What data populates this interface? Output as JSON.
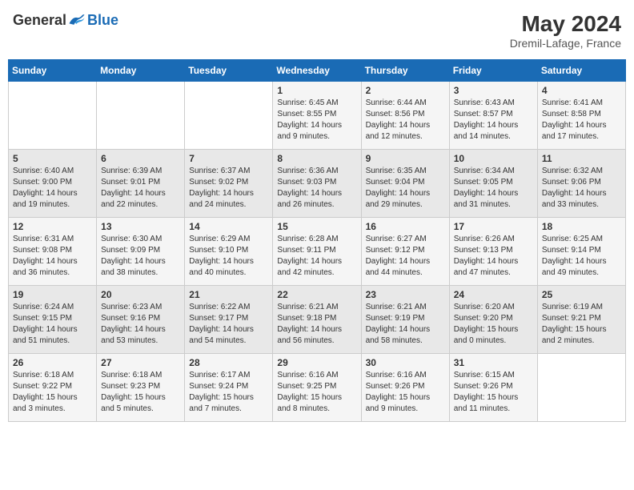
{
  "header": {
    "logo_general": "General",
    "logo_blue": "Blue",
    "month_title": "May 2024",
    "location": "Dremil-Lafage, France"
  },
  "days_of_week": [
    "Sunday",
    "Monday",
    "Tuesday",
    "Wednesday",
    "Thursday",
    "Friday",
    "Saturday"
  ],
  "weeks": [
    {
      "days": [
        {
          "num": "",
          "empty": true
        },
        {
          "num": "",
          "empty": true
        },
        {
          "num": "",
          "empty": true
        },
        {
          "num": "1",
          "sunrise": "6:45 AM",
          "sunset": "8:55 PM",
          "daylight": "14 hours and 9 minutes."
        },
        {
          "num": "2",
          "sunrise": "6:44 AM",
          "sunset": "8:56 PM",
          "daylight": "14 hours and 12 minutes."
        },
        {
          "num": "3",
          "sunrise": "6:43 AM",
          "sunset": "8:57 PM",
          "daylight": "14 hours and 14 minutes."
        },
        {
          "num": "4",
          "sunrise": "6:41 AM",
          "sunset": "8:58 PM",
          "daylight": "14 hours and 17 minutes."
        }
      ]
    },
    {
      "days": [
        {
          "num": "5",
          "sunrise": "6:40 AM",
          "sunset": "9:00 PM",
          "daylight": "14 hours and 19 minutes."
        },
        {
          "num": "6",
          "sunrise": "6:39 AM",
          "sunset": "9:01 PM",
          "daylight": "14 hours and 22 minutes."
        },
        {
          "num": "7",
          "sunrise": "6:37 AM",
          "sunset": "9:02 PM",
          "daylight": "14 hours and 24 minutes."
        },
        {
          "num": "8",
          "sunrise": "6:36 AM",
          "sunset": "9:03 PM",
          "daylight": "14 hours and 26 minutes."
        },
        {
          "num": "9",
          "sunrise": "6:35 AM",
          "sunset": "9:04 PM",
          "daylight": "14 hours and 29 minutes."
        },
        {
          "num": "10",
          "sunrise": "6:34 AM",
          "sunset": "9:05 PM",
          "daylight": "14 hours and 31 minutes."
        },
        {
          "num": "11",
          "sunrise": "6:32 AM",
          "sunset": "9:06 PM",
          "daylight": "14 hours and 33 minutes."
        }
      ]
    },
    {
      "days": [
        {
          "num": "12",
          "sunrise": "6:31 AM",
          "sunset": "9:08 PM",
          "daylight": "14 hours and 36 minutes."
        },
        {
          "num": "13",
          "sunrise": "6:30 AM",
          "sunset": "9:09 PM",
          "daylight": "14 hours and 38 minutes."
        },
        {
          "num": "14",
          "sunrise": "6:29 AM",
          "sunset": "9:10 PM",
          "daylight": "14 hours and 40 minutes."
        },
        {
          "num": "15",
          "sunrise": "6:28 AM",
          "sunset": "9:11 PM",
          "daylight": "14 hours and 42 minutes."
        },
        {
          "num": "16",
          "sunrise": "6:27 AM",
          "sunset": "9:12 PM",
          "daylight": "14 hours and 44 minutes."
        },
        {
          "num": "17",
          "sunrise": "6:26 AM",
          "sunset": "9:13 PM",
          "daylight": "14 hours and 47 minutes."
        },
        {
          "num": "18",
          "sunrise": "6:25 AM",
          "sunset": "9:14 PM",
          "daylight": "14 hours and 49 minutes."
        }
      ]
    },
    {
      "days": [
        {
          "num": "19",
          "sunrise": "6:24 AM",
          "sunset": "9:15 PM",
          "daylight": "14 hours and 51 minutes."
        },
        {
          "num": "20",
          "sunrise": "6:23 AM",
          "sunset": "9:16 PM",
          "daylight": "14 hours and 53 minutes."
        },
        {
          "num": "21",
          "sunrise": "6:22 AM",
          "sunset": "9:17 PM",
          "daylight": "14 hours and 54 minutes."
        },
        {
          "num": "22",
          "sunrise": "6:21 AM",
          "sunset": "9:18 PM",
          "daylight": "14 hours and 56 minutes."
        },
        {
          "num": "23",
          "sunrise": "6:21 AM",
          "sunset": "9:19 PM",
          "daylight": "14 hours and 58 minutes."
        },
        {
          "num": "24",
          "sunrise": "6:20 AM",
          "sunset": "9:20 PM",
          "daylight": "15 hours and 0 minutes."
        },
        {
          "num": "25",
          "sunrise": "6:19 AM",
          "sunset": "9:21 PM",
          "daylight": "15 hours and 2 minutes."
        }
      ]
    },
    {
      "days": [
        {
          "num": "26",
          "sunrise": "6:18 AM",
          "sunset": "9:22 PM",
          "daylight": "15 hours and 3 minutes."
        },
        {
          "num": "27",
          "sunrise": "6:18 AM",
          "sunset": "9:23 PM",
          "daylight": "15 hours and 5 minutes."
        },
        {
          "num": "28",
          "sunrise": "6:17 AM",
          "sunset": "9:24 PM",
          "daylight": "15 hours and 7 minutes."
        },
        {
          "num": "29",
          "sunrise": "6:16 AM",
          "sunset": "9:25 PM",
          "daylight": "15 hours and 8 minutes."
        },
        {
          "num": "30",
          "sunrise": "6:16 AM",
          "sunset": "9:26 PM",
          "daylight": "15 hours and 9 minutes."
        },
        {
          "num": "31",
          "sunrise": "6:15 AM",
          "sunset": "9:26 PM",
          "daylight": "15 hours and 11 minutes."
        },
        {
          "num": "",
          "empty": true
        }
      ]
    }
  ]
}
